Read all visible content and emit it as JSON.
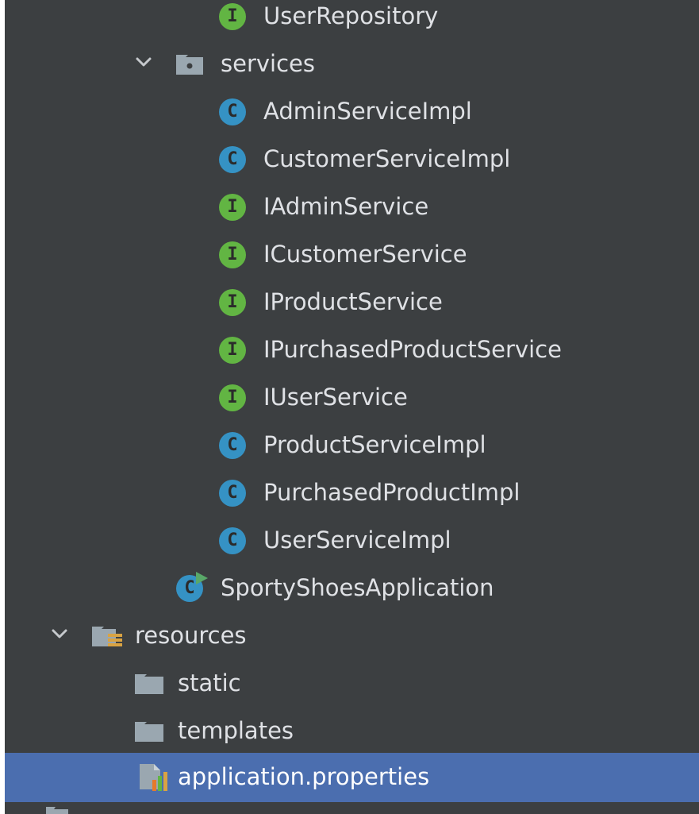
{
  "tree": {
    "items": [
      {
        "label": "UserRepository",
        "kind": "interface",
        "badge": "I"
      },
      {
        "label": "services",
        "kind": "package",
        "expanded": true
      },
      {
        "label": "AdminServiceImpl",
        "kind": "class",
        "badge": "C"
      },
      {
        "label": "CustomerServiceImpl",
        "kind": "class",
        "badge": "C"
      },
      {
        "label": "IAdminService",
        "kind": "interface",
        "badge": "I"
      },
      {
        "label": "ICustomerService",
        "kind": "interface",
        "badge": "I"
      },
      {
        "label": "IProductService",
        "kind": "interface",
        "badge": "I"
      },
      {
        "label": "IPurchasedProductService",
        "kind": "interface",
        "badge": "I"
      },
      {
        "label": "IUserService",
        "kind": "interface",
        "badge": "I"
      },
      {
        "label": "ProductServiceImpl",
        "kind": "class",
        "badge": "C"
      },
      {
        "label": "PurchasedProductImpl",
        "kind": "class",
        "badge": "C"
      },
      {
        "label": "UserServiceImpl",
        "kind": "class",
        "badge": "C"
      },
      {
        "label": "SportyShoesApplication",
        "kind": "spring-boot-main-class",
        "badge": "C"
      },
      {
        "label": "resources",
        "kind": "resources-root",
        "expanded": true
      },
      {
        "label": "static",
        "kind": "folder"
      },
      {
        "label": "templates",
        "kind": "folder"
      },
      {
        "label": "application.properties",
        "kind": "properties-file",
        "selected": true
      }
    ]
  },
  "colors": {
    "panel_background": "#3c3f41",
    "selection": "#4b6eaf",
    "text": "#dfe1e5",
    "class_icon": "#3592c4",
    "interface_icon": "#62b543",
    "folder_icon": "#9aa7b0",
    "run_arrow": "#59a869"
  }
}
